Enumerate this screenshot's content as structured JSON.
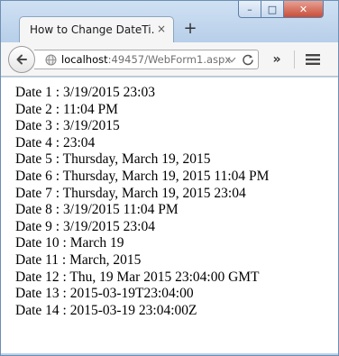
{
  "window": {
    "controls": {
      "minimize": "–",
      "maximize": "□",
      "close": "✕"
    }
  },
  "tab": {
    "title": "How to Change DateTi...",
    "close": "×",
    "new_tab": "+"
  },
  "toolbar": {
    "url_host": "localhost",
    "url_rest": ":49457/WebForm1.aspx",
    "overflow": "»"
  },
  "dates": [
    "Date 1 : 3/19/2015 23:03",
    "Date 2 : 11:04 PM",
    "Date 3 : 3/19/2015",
    "Date 4 : 23:04",
    "Date 5 : Thursday, March 19, 2015",
    "Date 6 : Thursday, March 19, 2015 11:04 PM",
    "Date 7 : Thursday, March 19, 2015 23:04",
    "Date 8 : 3/19/2015 11:04 PM",
    "Date 9 : 3/19/2015 23:04",
    "Date 10 : March 19",
    "Date 11 : March, 2015",
    "Date 12 : Thu, 19 Mar 2015 23:04:00 GMT",
    "Date 13 : 2015-03-19T23:04:00",
    "Date 14 : 2015-03-19 23:04:00Z"
  ],
  "icons": [
    "back-arrow-icon",
    "globe-icon",
    "dropdown-icon",
    "reload-icon",
    "overflow-icon",
    "menu-icon"
  ]
}
